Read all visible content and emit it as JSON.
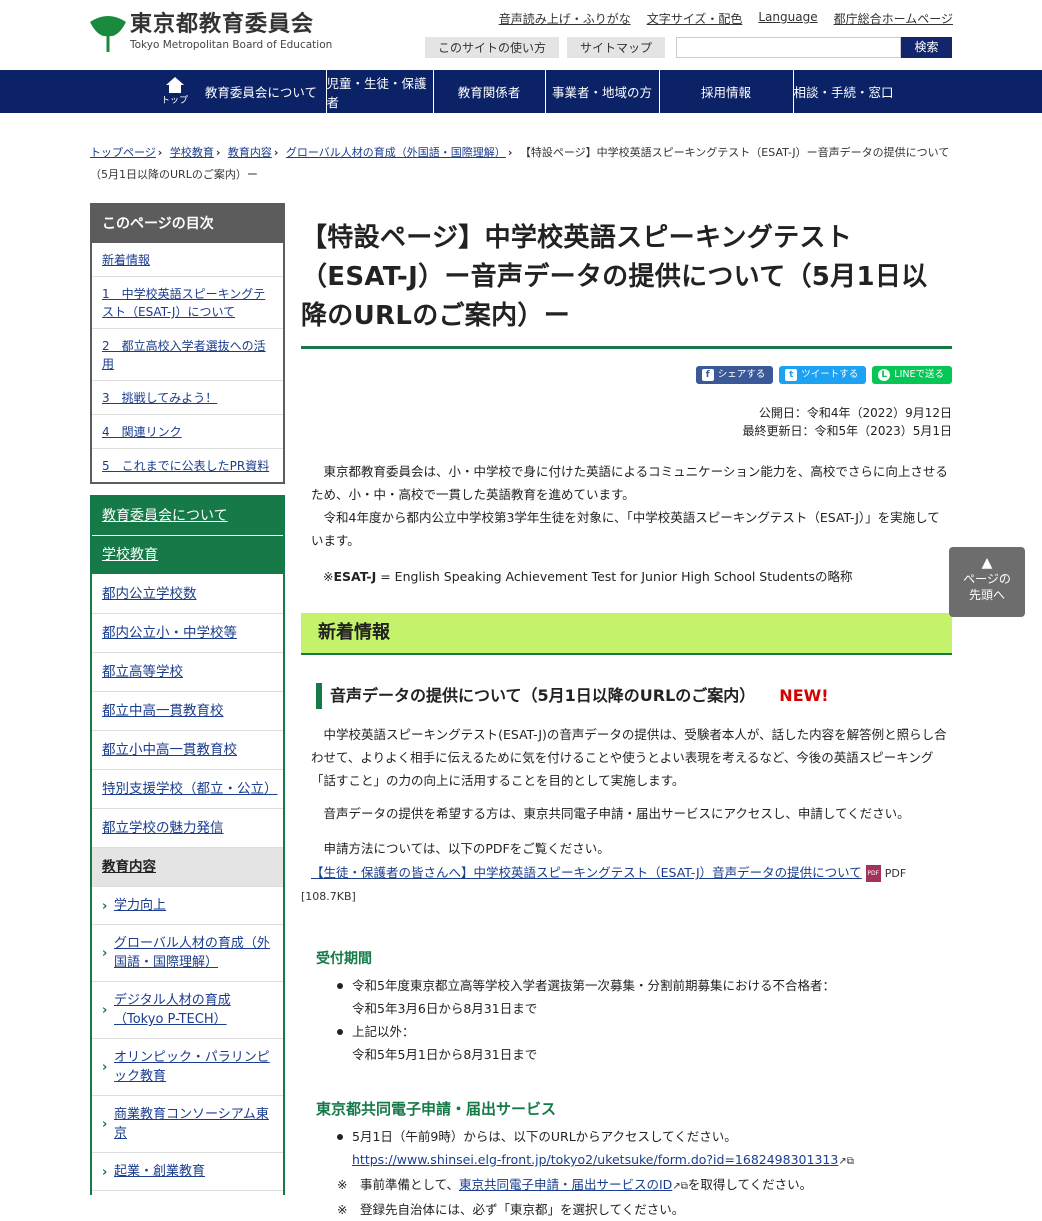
{
  "header": {
    "logo_ja": "東京都教育委員会",
    "logo_en": "Tokyo Metropolitan Board of Education",
    "util_links": [
      "音声読み上げ・ふりがな",
      "文字サイズ・配色",
      "Language",
      "都庁総合ホームページ"
    ],
    "usage_button": "このサイトの使い方",
    "sitemap_button": "サイトマップ",
    "search_placeholder": "",
    "search_button": "検索"
  },
  "nav": {
    "top_label": "トップ",
    "items": [
      "教育委員会について",
      "児童・生徒・保護者",
      "教育関係者",
      "事業者・地域の方",
      "採用情報",
      "相談・手続・窓口"
    ]
  },
  "breadcrumb": {
    "links": [
      "トップページ",
      "学校教育",
      "教育内容",
      "グローバル人材の育成（外国語・国際理解）"
    ],
    "current": "【特設ページ】中学校英語スピーキングテスト（ESAT-J）ー音声データの提供について（5月1日以降のURLのご案内）ー"
  },
  "toc": {
    "title": "このページの目次",
    "items": [
      "新着情報",
      "1　中学校英語スピーキングテスト（ESAT-J）について",
      "2　都立高校入学者選抜への活用",
      "3　挑戦してみよう！",
      "4　関連リンク",
      "5　これまでに公表したPR資料"
    ]
  },
  "sidenav": {
    "heads": [
      "教育委員会について",
      "学校教育"
    ],
    "items": [
      "都内公立学校数",
      "都内公立小・中学校等",
      "都立高等学校",
      "都立中高一貫教育校",
      "都立小中高一貫教育校",
      "特別支援学校（都立・公立）",
      "都立学校の魅力発信"
    ],
    "selected": "教育内容",
    "subs": [
      "学力向上",
      "グローバル人材の育成（外国語・国際理解）",
      "デジタル人材の育成（Tokyo P-TECH）",
      "オリンピック・パラリンピック教育",
      "商業教育コンソーシアム東京",
      "起業・創業教育"
    ]
  },
  "main": {
    "title": "【特設ページ】中学校英語スピーキングテスト（ESAT-J）ー音声データの提供について（5月1日以降のURLのご案内）ー",
    "social": {
      "facebook": "シェアする",
      "twitter": "ツイートする",
      "line": "LINEで送る"
    },
    "published": "公開日：令和4年（2022）9月12日",
    "updated": "最終更新日：令和5年（2023）5月1日",
    "intro1": "東京都教育委員会は、小・中学校で身に付けた英語によるコミュニケーション能力を、高校でさらに向上させるため、小・中・高校で一貫した英語教育を進めています。",
    "intro2": "令和4年度から都内公立中学校第3学年生徒を対象に、「中学校英語スピーキングテスト（ESAT-J）」を実施しています。",
    "abbr_prefix": "※",
    "abbr_term": "ESAT-J",
    "abbr_rest": " = English Speaking Achievement Test for Junior High School Studentsの略称",
    "news_heading": "新着情報",
    "audio_heading": "音声データの提供について（5月1日以降のURLのご案内）",
    "new_badge": "NEW!",
    "p1": "中学校英語スピーキングテスト(ESAT-J)の音声データの提供は、受験者本人が、話した内容を解答例と照らし合わせて、よりよく相手に伝えるために気を付けることや使うとよい表現を考えるなど、今後の英語スピーキング「話すこと」の力の向上に活用することを目的として実施します。",
    "p2": "音声データの提供を希望する方は、東京共同電子申請・届出サービスにアクセスし、申請してください。",
    "p3": "申請方法については、以下のPDFをご覧ください。",
    "pdf_link": "【生徒・保護者の皆さんへ】中学校英語スピーキングテスト（ESAT-J）音声データの提供について",
    "pdf_icon": "PDF",
    "pdf_label": "PDF",
    "pdf_size": "[108.7KB]",
    "period_heading": "受付期間",
    "period_items": [
      {
        "line1": "令和5年度東京都立高等学校入学者選抜第一次募集・分割前期募集における不合格者：",
        "line2": "令和5年3月6日から8月31日まで"
      },
      {
        "line1": "上記以外：",
        "line2": "令和5年5月1日から8月31日まで"
      }
    ],
    "service_heading": "東京都共同電子申請・届出サービス",
    "service_item": "5月1日（午前9時）からは、以下のURLからアクセスしてください。",
    "service_url": "https://www.shinsei.elg-front.jp/tokyo2/uketsuke/form.do?id=1682498301313",
    "note1_mark": "※",
    "note1_pre": "　事前準備として、",
    "note1_link": "東京共同電子申請・届出サービスのID",
    "note1_post": "を取得してください。",
    "note2": "※　登録先自治体には、必ず「東京都」を選択してください。"
  },
  "pagetop": {
    "line1": "ページの",
    "line2": "先頭へ"
  },
  "colors": {
    "navy": "#0b2266",
    "green": "#157a48",
    "lime": "#c4f26a",
    "new": "#d40000",
    "toc_gray": "#5c5c5c"
  }
}
